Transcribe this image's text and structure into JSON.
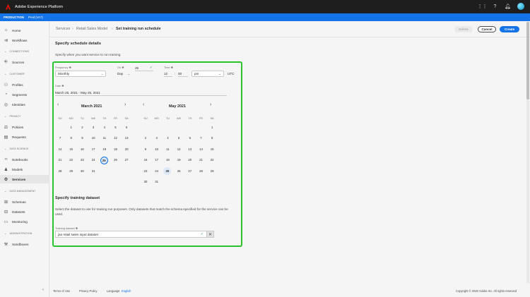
{
  "topbar": {
    "title": "Adobe Experience Platform"
  },
  "env": {
    "label": "PRODUCTION",
    "sandbox": "Prod (VA7)"
  },
  "sidebar": {
    "items": [
      {
        "label": "Home",
        "icon": "home-icon",
        "glyph": "⌂"
      },
      {
        "label": "Workflows",
        "icon": "workflow-icon",
        "glyph": "⇉"
      },
      {
        "label": "Sources",
        "icon": "sources-icon",
        "glyph": "⎆"
      },
      {
        "label": "Profiles",
        "icon": "user-icon",
        "glyph": "👤"
      },
      {
        "label": "Segments",
        "icon": "segment-icon",
        "glyph": "◔"
      },
      {
        "label": "Identities",
        "icon": "identity-icon",
        "glyph": "◎"
      },
      {
        "label": "Policies",
        "icon": "policy-icon",
        "glyph": "⚖"
      },
      {
        "label": "Requests",
        "icon": "request-icon",
        "glyph": "▤"
      },
      {
        "label": "Notebooks",
        "icon": "notebook-icon",
        "glyph": "‹›"
      },
      {
        "label": "Models",
        "icon": "model-icon",
        "glyph": "♟"
      },
      {
        "label": "Services",
        "icon": "services-icon",
        "glyph": "⚙"
      },
      {
        "label": "Schemas",
        "icon": "schema-icon",
        "glyph": "⊞"
      },
      {
        "label": "Datasets",
        "icon": "dataset-icon",
        "glyph": "⊟"
      },
      {
        "label": "Monitoring",
        "icon": "monitor-icon",
        "glyph": "▭"
      },
      {
        "label": "Sandboxes",
        "icon": "sandbox-icon",
        "glyph": "⚒"
      }
    ],
    "sections": [
      "CONNECTIONS",
      "CUSTOMER",
      "PRIVACY",
      "DATA SCIENCE",
      "DATA MANAGEMENT",
      "ADMINISTRATION"
    ],
    "active": "Services"
  },
  "breadcrumb": {
    "items": [
      "Services",
      "Retail Sales Model"
    ],
    "current": "Set training run schedule"
  },
  "actions": {
    "delete": "Delete",
    "cancel": "Cancel",
    "create": "Create"
  },
  "schedule": {
    "title": "Specify schedule details",
    "subtitle": "Specify when you want service to run training.",
    "frequency_label": "Frequency ✱",
    "frequency_value": "Monthly",
    "on_label": "On ✱",
    "on_unit": "Day",
    "on_value": "25",
    "time_label": "Time ✱",
    "time_hour": "12",
    "time_min": "00",
    "time_ampm": "pm",
    "timezone": "UTC",
    "date_label": "Date ✱",
    "date_range": "March 25, 2021 - May 25, 2021"
  },
  "calendar": {
    "weekdays": [
      "SU",
      "MO",
      "TU",
      "WE",
      "TH",
      "FR",
      "SA"
    ],
    "months": [
      {
        "title": "March 2021",
        "first_dow": 1,
        "days": 31,
        "selected": 25
      },
      {
        "title": "May 2021",
        "first_dow": 6,
        "days": 31,
        "selected": 25
      }
    ]
  },
  "dataset": {
    "title": "Specify training dataset",
    "description": "Select the dataset to use for training run purposes. Only datasets that match the schema specified for the service can be used.",
    "label": "Training dataset ✱",
    "value": "jan retail sales input dataset"
  },
  "footer": {
    "terms": "Terms of Use",
    "privacy": "Privacy Policy",
    "language_label": "Language:",
    "language": "English",
    "copyright": "Copyright © 2020 Adobe Inc. All rights reserved"
  },
  "colors": {
    "accent": "#1473e6",
    "highlight": "#2ec12e",
    "success": "#268e6c"
  }
}
